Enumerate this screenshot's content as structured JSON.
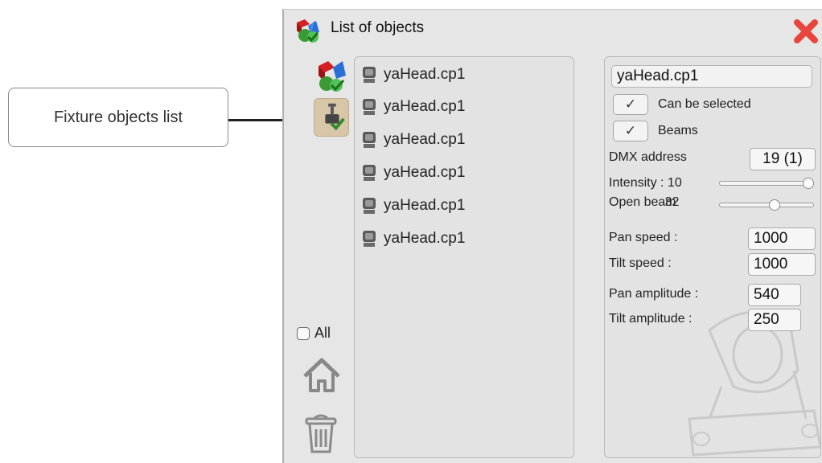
{
  "callout": {
    "text": "Fixture objects list"
  },
  "window": {
    "title": "List of objects",
    "icons": {
      "title": "objects-cube-icon",
      "close": "close-x-icon"
    },
    "accent_close": "#e8453c",
    "selected_tool_bg": "#d8c6a8"
  },
  "toolbar": {
    "all_label": "All",
    "all_checked": false
  },
  "list": {
    "items": [
      {
        "label": "yaHead.cp1"
      },
      {
        "label": "yaHead.cp1"
      },
      {
        "label": "yaHead.cp1"
      },
      {
        "label": "yaHead.cp1"
      },
      {
        "label": "yaHead.cp1"
      },
      {
        "label": "yaHead.cp1"
      }
    ]
  },
  "props": {
    "name": "yaHead.cp1",
    "can_be_selected": {
      "label": "Can be selected",
      "checked": true
    },
    "beams": {
      "label": "Beams",
      "checked": true
    },
    "dmx_label": "DMX address",
    "dmx_value": "19 (1)",
    "intensity_label": "Intensity : 10",
    "intensity_fraction": 1.0,
    "open_beam_label": "Open beam",
    "open_beam_value": "32",
    "open_beam_fraction": 0.6,
    "pan_speed_label": "Pan speed :",
    "pan_speed_value": "1000",
    "tilt_speed_label": "Tilt speed :",
    "tilt_speed_value": "1000",
    "pan_amp_label": "Pan amplitude :",
    "pan_amp_value": "540",
    "tilt_amp_label": "Tilt amplitude :",
    "tilt_amp_value": "250"
  }
}
